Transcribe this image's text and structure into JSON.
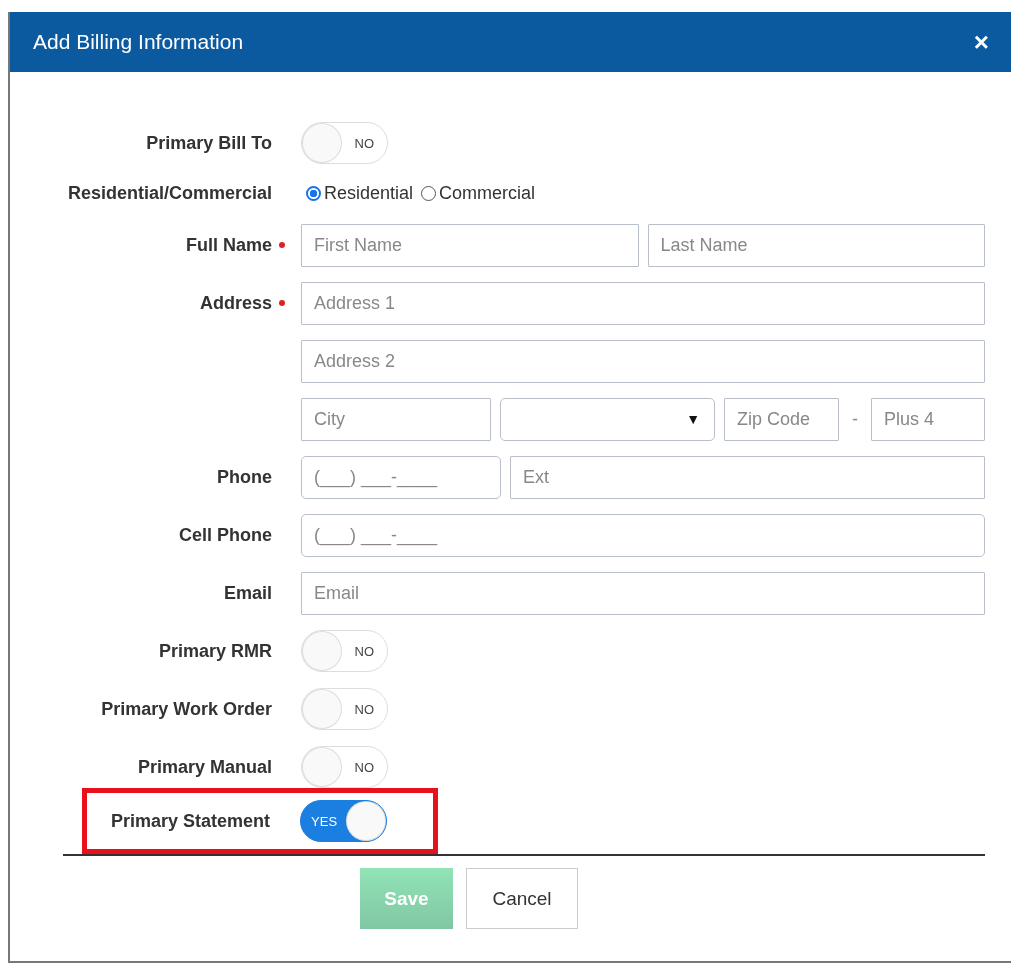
{
  "dialog": {
    "title": "Add Billing Information",
    "close": "×"
  },
  "rows": [
    {
      "kind": "toggle",
      "label": "Primary Bill To",
      "on": false,
      "text": "NO"
    },
    {
      "kind": "radio",
      "label": "Residential/Commercial",
      "options": [
        {
          "label": "Residential",
          "selected": true
        },
        {
          "label": "Commercial",
          "selected": false
        }
      ]
    },
    {
      "kind": "fields",
      "label": "Full Name",
      "required": true,
      "fields": [
        {
          "kind": "input",
          "placeholder": "First Name"
        },
        {
          "kind": "input",
          "placeholder": "Last Name"
        }
      ]
    },
    {
      "kind": "fields",
      "label": "Address",
      "required": true,
      "fields": [
        {
          "kind": "input",
          "placeholder": "Address 1"
        }
      ]
    },
    {
      "kind": "fields",
      "fields": [
        {
          "kind": "input",
          "placeholder": "Address 2"
        }
      ]
    },
    {
      "kind": "fields",
      "fields": [
        {
          "kind": "input",
          "placeholder": "City"
        },
        {
          "kind": "select",
          "caret": "▼"
        },
        {
          "kind": "input",
          "placeholder": "Zip Code"
        },
        {
          "kind": "separator",
          "text": "-"
        },
        {
          "kind": "input",
          "placeholder": "Plus 4"
        }
      ]
    },
    {
      "kind": "fields",
      "label": "Phone",
      "fields": [
        {
          "kind": "masked",
          "placeholder": "(___) ___-____"
        },
        {
          "kind": "input",
          "placeholder": "Ext"
        }
      ]
    },
    {
      "kind": "fields",
      "label": "Cell Phone",
      "fields": [
        {
          "kind": "masked",
          "placeholder": "(___) ___-____"
        }
      ]
    },
    {
      "kind": "fields",
      "label": "Email",
      "fields": [
        {
          "kind": "input",
          "placeholder": "Email"
        }
      ]
    },
    {
      "kind": "toggle",
      "label": "Primary RMR",
      "on": false,
      "text": "NO"
    },
    {
      "kind": "toggle",
      "label": "Primary Work Order",
      "on": false,
      "text": "NO"
    },
    {
      "kind": "toggle",
      "label": "Primary Manual",
      "on": false,
      "text": "NO"
    },
    {
      "kind": "toggle",
      "label": "Primary Statement",
      "on": true,
      "text": "YES",
      "highlighted": true
    }
  ],
  "buttons": [
    {
      "kind": "primary",
      "label": "Save",
      "disabled": true
    },
    {
      "kind": "secondary",
      "label": "Cancel",
      "disabled": false
    }
  ]
}
